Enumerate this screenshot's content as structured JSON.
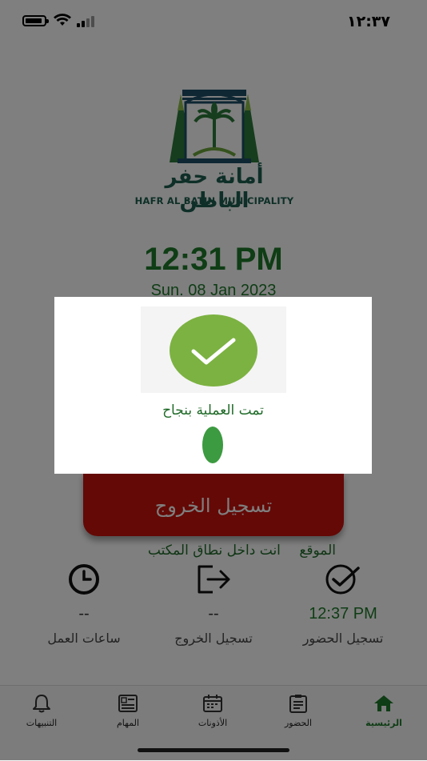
{
  "status_bar": {
    "time": "١٢:٣٧"
  },
  "logo": {
    "arabic_name": "أمانة حفر الباطن",
    "english_name": "HAFR AL BATIN MUNICIPALITY"
  },
  "clock": {
    "time": "12:31 PM",
    "date": "Sun. 08 Jan 2023"
  },
  "checkout_button": {
    "label": "تسجيل الخروج"
  },
  "location": {
    "label": "الموقع",
    "value": "انت داخل نطاق المكتب"
  },
  "stats": [
    {
      "label": "تسجيل الحضور",
      "value": "12:37 PM",
      "icon": "check-circle-icon"
    },
    {
      "label": "تسجيل الخروج",
      "value": "--",
      "icon": "logout-icon"
    },
    {
      "label": "ساعات العمل",
      "value": "--",
      "icon": "clock-icon"
    }
  ],
  "bottom_nav": {
    "items": [
      {
        "label": "الرئيسية",
        "icon": "home-icon",
        "active": true
      },
      {
        "label": "الحضور",
        "icon": "clipboard-icon",
        "active": false
      },
      {
        "label": "الأذونات",
        "icon": "calendar-icon",
        "active": false
      },
      {
        "label": "المهام",
        "icon": "tasks-icon",
        "active": false
      },
      {
        "label": "التنبيهات",
        "icon": "bell-icon",
        "active": false
      }
    ]
  },
  "modal": {
    "message": "تمت العملية بنجاح"
  },
  "colors": {
    "brand_green": "#1f7a2a",
    "checkout_red": "#c8120c",
    "success_green": "#7cb241"
  }
}
